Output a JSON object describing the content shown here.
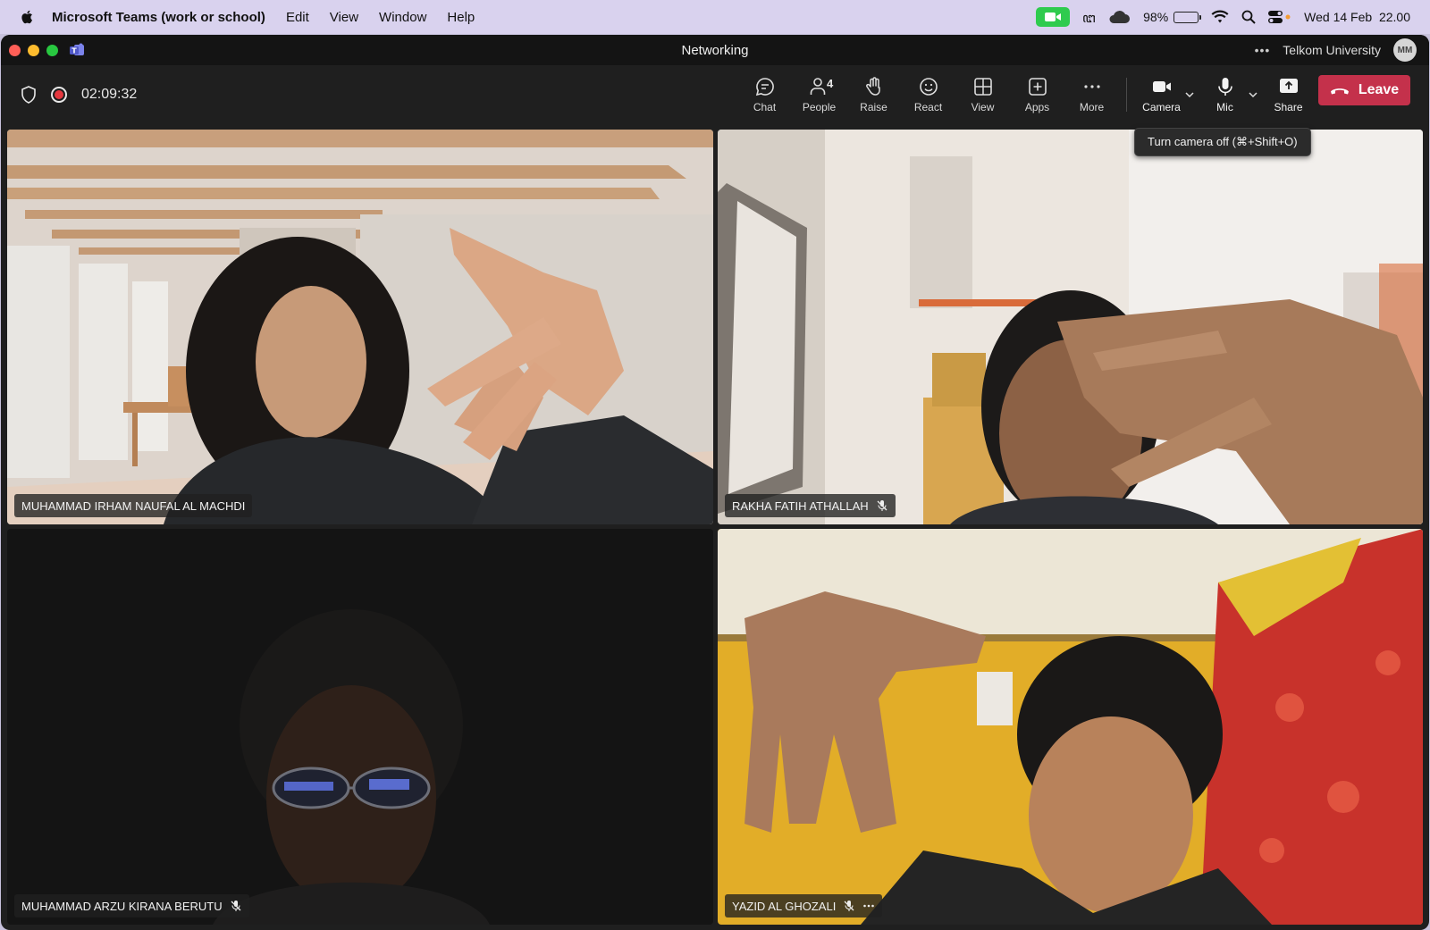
{
  "menubar": {
    "app_name": "Microsoft Teams (work or school)",
    "items": [
      "Edit",
      "View",
      "Window",
      "Help"
    ],
    "battery_percent": "98%",
    "battery_level": 0.98,
    "datetime": "Wed 14 Feb  22.00"
  },
  "window": {
    "title": "Networking",
    "org_name": "Telkom University",
    "avatar_initials": "MM"
  },
  "toolbar": {
    "elapsed": "02:09:32",
    "buttons": {
      "chat": "Chat",
      "people": "People",
      "people_count": "4",
      "raise": "Raise",
      "react": "React",
      "view": "View",
      "apps": "Apps",
      "more": "More",
      "camera": "Camera",
      "mic": "Mic",
      "share": "Share"
    },
    "leave_label": "Leave",
    "tooltip": "Turn camera off (⌘+Shift+O)"
  },
  "participants": [
    {
      "name": "MUHAMMAD IRHAM NAUFAL AL MACHDI",
      "muted": false
    },
    {
      "name": "RAKHA FATIH ATHALLAH",
      "muted": true
    },
    {
      "name": "MUHAMMAD ARZU KIRANA BERUTU",
      "muted": true
    },
    {
      "name": "YAZID AL GHOZALI",
      "muted": true,
      "has_more": true
    }
  ],
  "colors": {
    "menubar_bg": "#d9d2ee",
    "window_bg": "#1f1f1f",
    "leave_red": "#c4314b",
    "recording_red": "#e4373e",
    "facetime_green": "#2fcb4e"
  }
}
